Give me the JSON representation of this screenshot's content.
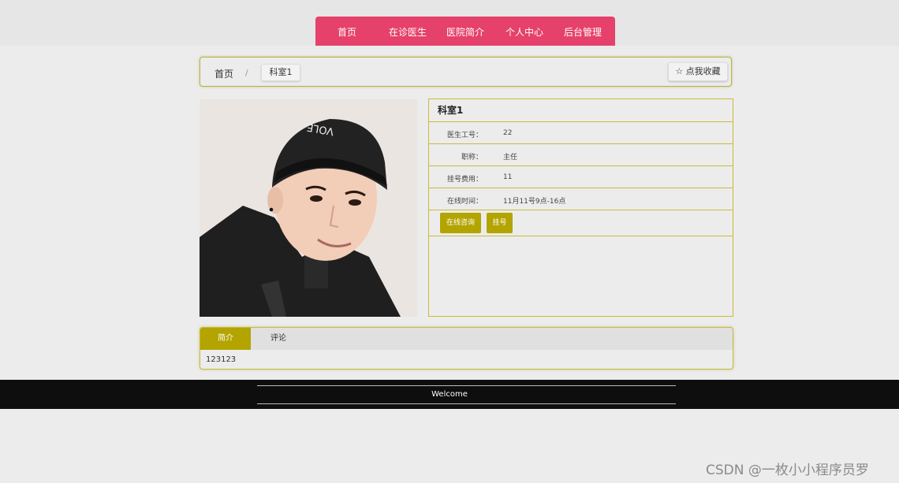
{
  "nav": {
    "items": [
      "首页",
      "在诊医生",
      "医院简介",
      "个人中心",
      "后台管理"
    ],
    "color": "#e5416a"
  },
  "breadcrumb": {
    "home": "首页",
    "separator": "/",
    "current": "科室1",
    "favorite_label": "☆ 点我收藏"
  },
  "doctor": {
    "title": "科室1",
    "rows": [
      {
        "label": "医生工号：",
        "value": "22"
      },
      {
        "label": "职称：",
        "value": "主任"
      },
      {
        "label": "挂号费用：",
        "value": "11"
      },
      {
        "label": "在线时间：",
        "value": "11月11号9点-16点"
      }
    ],
    "actions": {
      "consult": "在线咨询",
      "register": "挂号"
    },
    "accent": "#b3a400"
  },
  "tabs": {
    "items": [
      "简介",
      "评论"
    ],
    "content": "123123"
  },
  "footer": {
    "text": "Welcome"
  },
  "watermark": "CSDN @一枚小小程序员罗"
}
